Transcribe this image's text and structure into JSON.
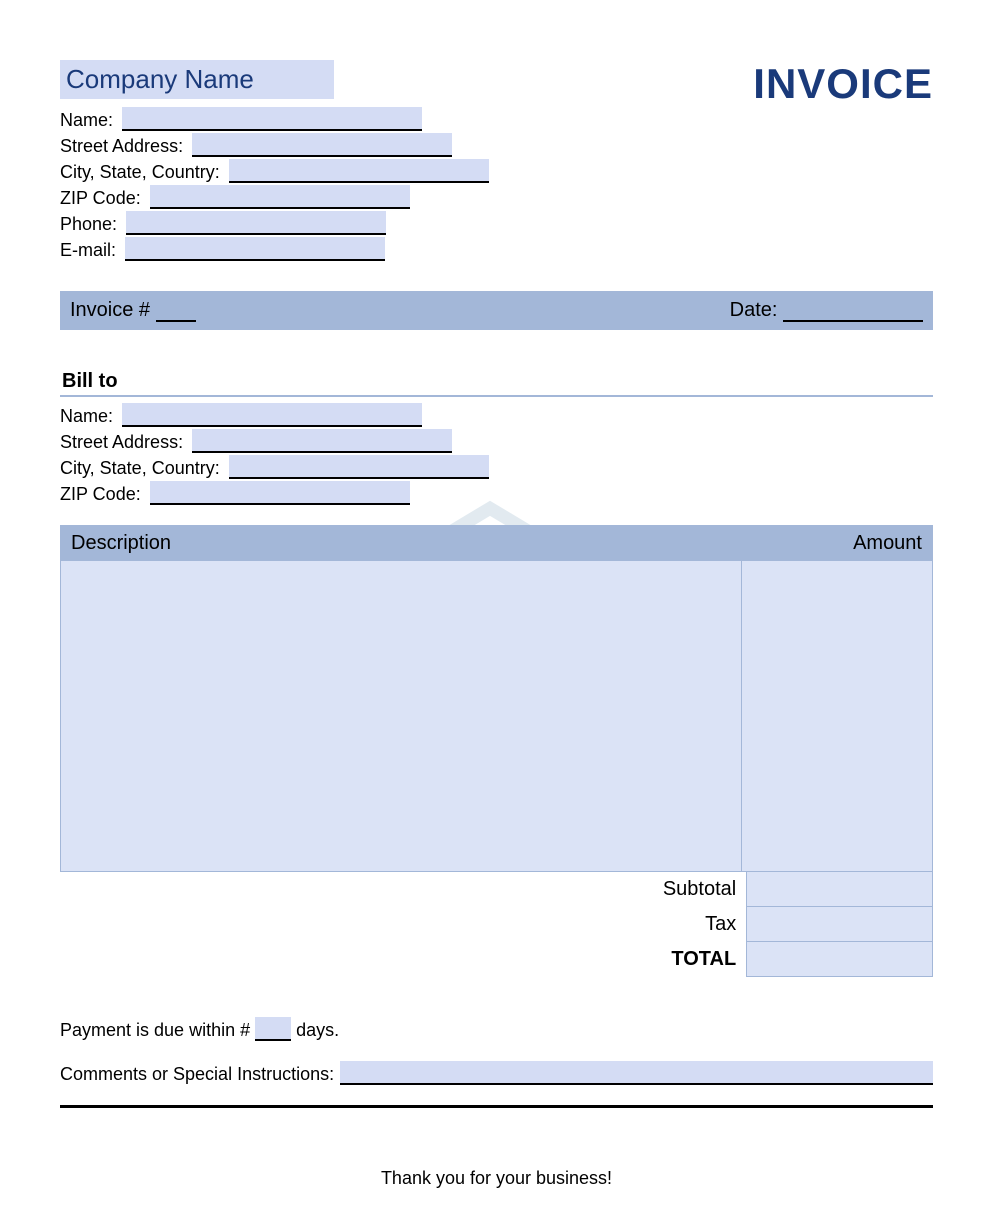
{
  "header": {
    "company_name_label": "Company Name",
    "invoice_title": "INVOICE"
  },
  "company": {
    "name_label": "Name:",
    "street_label": "Street Address:",
    "city_label": "City, State, Country:",
    "zip_label": "ZIP Code:",
    "phone_label": "Phone:",
    "email_label": "E-mail:"
  },
  "invoice_bar": {
    "number_label": "Invoice #",
    "date_label": "Date:"
  },
  "bill_to": {
    "title": "Bill to",
    "name_label": "Name:",
    "street_label": "Street Address:",
    "city_label": "City, State, Country:",
    "zip_label": "ZIP Code:"
  },
  "table": {
    "description_header": "Description",
    "amount_header": "Amount"
  },
  "totals": {
    "subtotal_label": "Subtotal",
    "tax_label": "Tax",
    "total_label": "TOTAL"
  },
  "payment": {
    "prefix": "Payment is due within #",
    "suffix": "days."
  },
  "comments": {
    "label": "Comments or Special Instructions:"
  },
  "footer": {
    "thanks": "Thank you for your business!"
  }
}
